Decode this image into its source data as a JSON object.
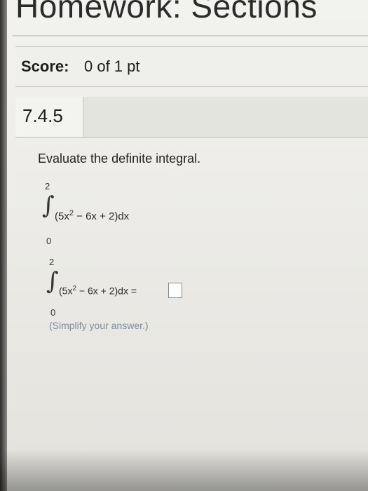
{
  "header": {
    "title": "Homework: Sections"
  },
  "score": {
    "label": "Score:",
    "value": "0 of 1 pt"
  },
  "question": {
    "number": "7.4.5",
    "prompt": "Evaluate the definite integral.",
    "integral_display": {
      "upper": "2",
      "lower": "0",
      "integrand": "(5x",
      "exponent": "2",
      "integrand_rest": " − 6x + 2)dx"
    },
    "answer_row": {
      "upper": "2",
      "lower": "0",
      "integrand": "(5x",
      "exponent": "2",
      "integrand_rest": " − 6x + 2)dx =",
      "answer_value": ""
    },
    "hint": "(Simplify your answer.)"
  }
}
